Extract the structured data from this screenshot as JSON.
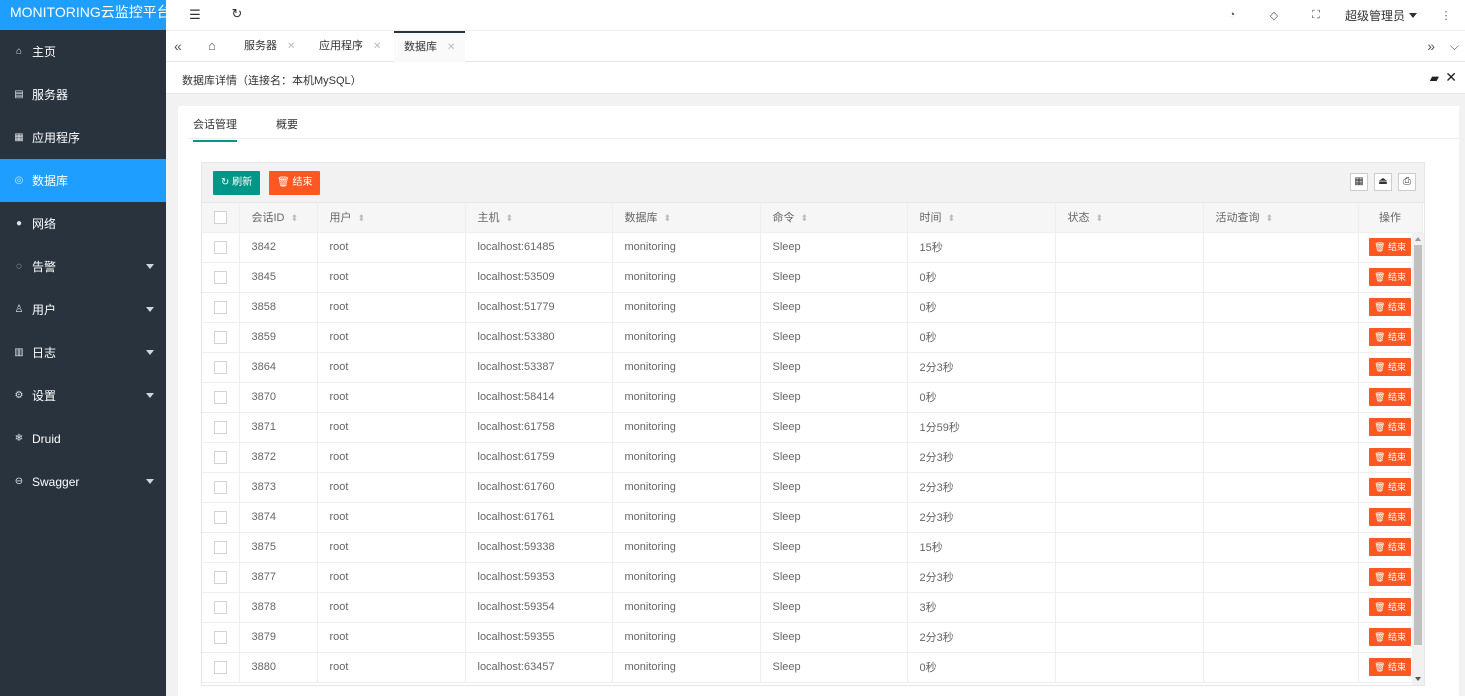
{
  "app": {
    "title": "MONITORING云监控平台"
  },
  "sidebar": {
    "items": [
      {
        "icon": "home-icon",
        "glyph": "⌂",
        "label": "主页",
        "active": false,
        "submenu": false
      },
      {
        "icon": "server-icon",
        "glyph": "▤",
        "label": "服务器",
        "active": false,
        "submenu": false
      },
      {
        "icon": "app-icon",
        "glyph": "▦",
        "label": "应用程序",
        "active": false,
        "submenu": false
      },
      {
        "icon": "database-icon",
        "glyph": "◎",
        "label": "数据库",
        "active": true,
        "submenu": false
      },
      {
        "icon": "network-icon",
        "glyph": "●",
        "label": "网络",
        "active": false,
        "submenu": false
      },
      {
        "icon": "bell-icon",
        "glyph": "◌",
        "label": "告警",
        "active": false,
        "submenu": true
      },
      {
        "icon": "user-icon",
        "glyph": "♙",
        "label": "用户",
        "active": false,
        "submenu": true
      },
      {
        "icon": "log-icon",
        "glyph": "▥",
        "label": "日志",
        "active": false,
        "submenu": true
      },
      {
        "icon": "gear-icon",
        "glyph": "⚙",
        "label": "设置",
        "active": false,
        "submenu": true
      },
      {
        "icon": "druid-icon",
        "glyph": "❄",
        "label": "Druid",
        "active": false,
        "submenu": false
      },
      {
        "icon": "swagger-icon",
        "glyph": "⊖",
        "label": "Swagger",
        "active": false,
        "submenu": true
      }
    ]
  },
  "header": {
    "user": "超级管理员"
  },
  "tabs": [
    {
      "label": "服务器",
      "active": false
    },
    {
      "label": "应用程序",
      "active": false
    },
    {
      "label": "数据库",
      "active": true
    }
  ],
  "page": {
    "title": "数据库详情（连接名：本机MySQL）",
    "subtabs": [
      "会话管理",
      "概要"
    ]
  },
  "toolbar": {
    "refresh_label": "刷新",
    "end_label": "结束"
  },
  "table": {
    "columns": [
      "会话ID",
      "用户",
      "主机",
      "数据库",
      "命令",
      "时间",
      "状态",
      "活动查询",
      "操作"
    ],
    "action_label": "结束",
    "rows": [
      [
        "3842",
        "root",
        "localhost:61485",
        "monitoring",
        "Sleep",
        "15秒",
        "",
        ""
      ],
      [
        "3845",
        "root",
        "localhost:53509",
        "monitoring",
        "Sleep",
        "0秒",
        "",
        ""
      ],
      [
        "3858",
        "root",
        "localhost:51779",
        "monitoring",
        "Sleep",
        "0秒",
        "",
        ""
      ],
      [
        "3859",
        "root",
        "localhost:53380",
        "monitoring",
        "Sleep",
        "0秒",
        "",
        ""
      ],
      [
        "3864",
        "root",
        "localhost:53387",
        "monitoring",
        "Sleep",
        "2分3秒",
        "",
        ""
      ],
      [
        "3870",
        "root",
        "localhost:58414",
        "monitoring",
        "Sleep",
        "0秒",
        "",
        ""
      ],
      [
        "3871",
        "root",
        "localhost:61758",
        "monitoring",
        "Sleep",
        "1分59秒",
        "",
        ""
      ],
      [
        "3872",
        "root",
        "localhost:61759",
        "monitoring",
        "Sleep",
        "2分3秒",
        "",
        ""
      ],
      [
        "3873",
        "root",
        "localhost:61760",
        "monitoring",
        "Sleep",
        "2分3秒",
        "",
        ""
      ],
      [
        "3874",
        "root",
        "localhost:61761",
        "monitoring",
        "Sleep",
        "2分3秒",
        "",
        ""
      ],
      [
        "3875",
        "root",
        "localhost:59338",
        "monitoring",
        "Sleep",
        "15秒",
        "",
        ""
      ],
      [
        "3877",
        "root",
        "localhost:59353",
        "monitoring",
        "Sleep",
        "2分3秒",
        "",
        ""
      ],
      [
        "3878",
        "root",
        "localhost:59354",
        "monitoring",
        "Sleep",
        "3秒",
        "",
        ""
      ],
      [
        "3879",
        "root",
        "localhost:59355",
        "monitoring",
        "Sleep",
        "2分3秒",
        "",
        ""
      ],
      [
        "3880",
        "root",
        "localhost:63457",
        "monitoring",
        "Sleep",
        "0秒",
        "",
        ""
      ]
    ]
  },
  "colors": {
    "accent": "#1e9fff",
    "sidebar": "#28333e",
    "green": "#009688",
    "orange": "#ff5722"
  }
}
